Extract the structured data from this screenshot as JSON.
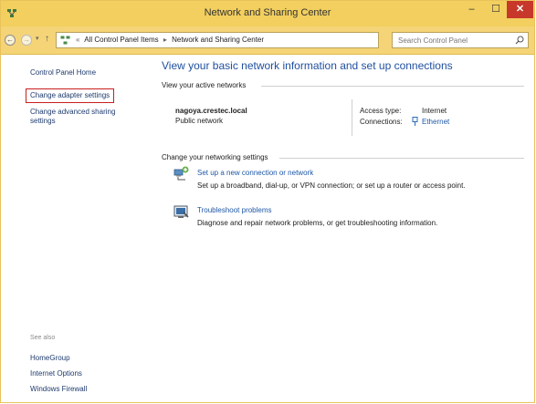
{
  "window": {
    "title": "Network and Sharing Center",
    "minimize_glyph": "–",
    "maximize_glyph": "☐",
    "close_glyph": "✕"
  },
  "address_bar": {
    "back_glyph": "←",
    "forward_glyph": "→",
    "up_glyph": "↑",
    "breadcrumb": [
      "«",
      "All Control Panel Items",
      "▸",
      "Network and Sharing Center"
    ],
    "search_placeholder": "Search Control Panel"
  },
  "left_pane": {
    "home": "Control Panel Home",
    "change_adapter": "Change adapter settings",
    "change_advanced": "Change advanced sharing settings",
    "see_also": "See also",
    "links": [
      "HomeGroup",
      "Internet Options",
      "Windows Firewall"
    ]
  },
  "main": {
    "title": "View your basic network information and set up connections",
    "active_networks_label": "View your active networks",
    "network": {
      "name": "nagoya.crestec.local",
      "type": "Public network",
      "access_type_label": "Access type:",
      "access_type_value": "Internet",
      "connections_label": "Connections:",
      "connections_value": "Ethernet"
    },
    "change_settings_label": "Change your networking settings",
    "tasks": [
      {
        "icon": "network-setup-icon",
        "link": "Set up a new connection or network",
        "description": "Set up a broadband, dial-up, or VPN connection; or set up a router or access point."
      },
      {
        "icon": "troubleshoot-icon",
        "link": "Troubleshoot problems",
        "description": "Diagnose and repair network problems, or get troubleshooting information."
      }
    ]
  },
  "colors": {
    "titlebar": "#f2cf5e",
    "link": "#1e57a6",
    "heading": "#1f4f9f",
    "close_button": "#c7382a",
    "highlight_border": "#c81e1e"
  }
}
